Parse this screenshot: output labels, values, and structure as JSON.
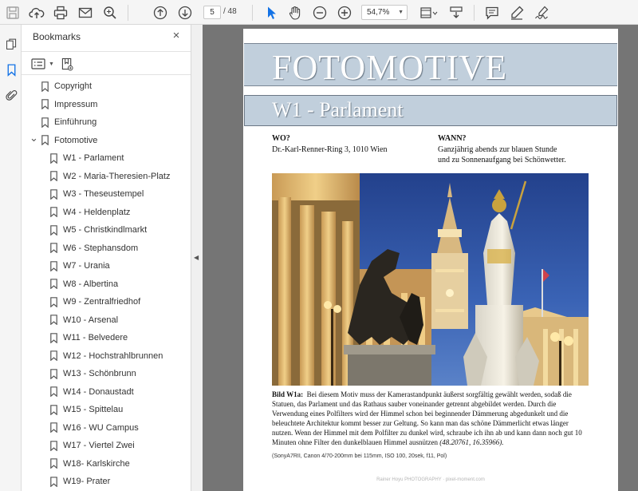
{
  "toolbar": {
    "page_current": "5",
    "page_total": "/ 48",
    "zoom": "54,7%"
  },
  "bookmarks": {
    "title": "Bookmarks",
    "close_glyph": "×",
    "items": [
      {
        "label": "Copyright",
        "level": 0
      },
      {
        "label": "Impressum",
        "level": 0
      },
      {
        "label": "Einführung",
        "level": 0
      },
      {
        "label": "Fotomotive",
        "level": 0,
        "expanded": true
      },
      {
        "label": "W1 - Parlament",
        "level": 1
      },
      {
        "label": "W2 - Maria-Theresien-Platz",
        "level": 1
      },
      {
        "label": "W3 - Theseustempel",
        "level": 1
      },
      {
        "label": "W4 - Heldenplatz",
        "level": 1
      },
      {
        "label": "W5 - Christkindlmarkt",
        "level": 1
      },
      {
        "label": "W6 - Stephansdom",
        "level": 1
      },
      {
        "label": "W7 - Urania",
        "level": 1
      },
      {
        "label": "W8 - Albertina",
        "level": 1
      },
      {
        "label": "W9 - Zentralfriedhof",
        "level": 1
      },
      {
        "label": "W10 - Arsenal",
        "level": 1
      },
      {
        "label": "W11 - Belvedere",
        "level": 1
      },
      {
        "label": "W12 - Hochstrahlbrunnen",
        "level": 1
      },
      {
        "label": "W13 - Schönbrunn",
        "level": 1
      },
      {
        "label": "W14 - Donaustadt",
        "level": 1
      },
      {
        "label": "W15 - Spittelau",
        "level": 1
      },
      {
        "label": "W16 - WU Campus",
        "level": 1
      },
      {
        "label": "W17 - Viertel Zwei",
        "level": 1
      },
      {
        "label": "W18- Karlskirche",
        "level": 1
      },
      {
        "label": "W19- Prater",
        "level": 1
      }
    ]
  },
  "document": {
    "heading": "FOTOMOTIVE",
    "subheading": "W1 - Parlament",
    "wo_label": "WO?",
    "wo_text": "Dr.-Karl-Renner-Ring 3, 1010 Wien",
    "wann_label": "WANN?",
    "wann_line1": "Ganzjährig abends zur blauen Stunde",
    "wann_line2": "und zu Sonnenaufgang bei Schönwetter.",
    "caption_label": "Bild W1a:",
    "caption_text": "Bei diesem Motiv muss der Kamerastandpunkt äußerst sorgfältig gewählt werden, sodaß die Statuen, das Parlament und das Rathaus sauber voneinander getrennt abgebildet werden. Durch die Verwendung eines Polfilters wird der Himmel schon bei beginnender Dämmerung abgedunkelt und die beleuchtete Architektur kommt besser zur Geltung. So kann man das schöne Dämmerlicht etwas länger nutzen. Wenn der Himmel mit dem Polfilter zu dunkel wird, schraube ich ihn ab und kann dann noch gut 10 Minuten ohne Filter den dunkelblauen Himmel ausnützen",
    "caption_coords": "(48.20761, 16.35966).",
    "camera_info": "(SonyA7RII, Canon 4/70-200mm bei 115mm, ISO 100, 20sek, f11, Pol)",
    "footer": "Rainer Hoyu PHOTOGRAPHY  ·  pixel-moment.com"
  },
  "colors": {
    "accent_blue": "#1473e6",
    "heading_band": "#c1cfdc",
    "doc_background": "#757575"
  }
}
